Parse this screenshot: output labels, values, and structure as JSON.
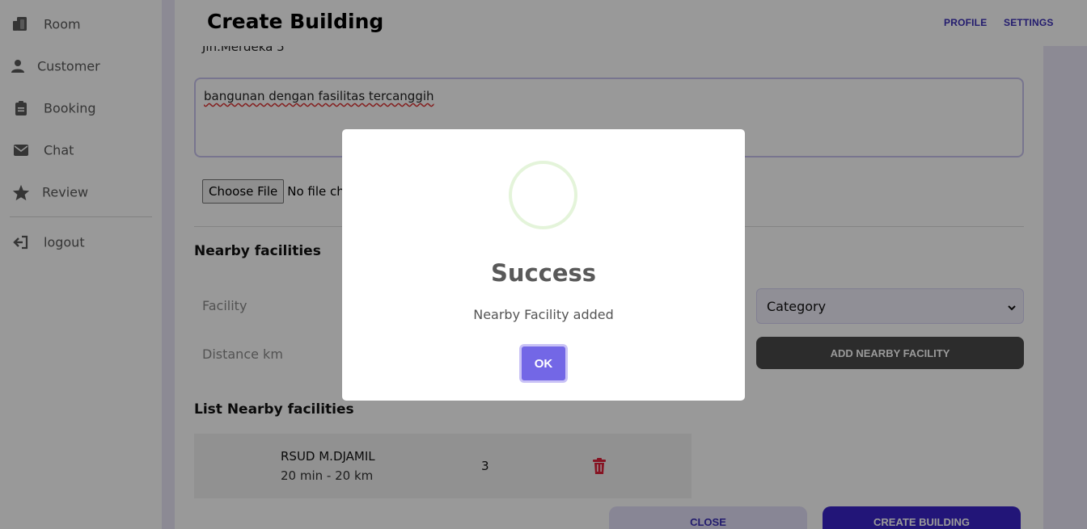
{
  "sidebar": {
    "items": [
      {
        "label": "Room",
        "icon": "room-icon"
      },
      {
        "label": "Customer",
        "icon": "user-icon"
      },
      {
        "label": "Booking",
        "icon": "clipboard-icon"
      },
      {
        "label": "Chat",
        "icon": "envelope-icon"
      },
      {
        "label": "Review",
        "icon": "star-icon"
      }
    ],
    "logout": {
      "label": "logout",
      "icon": "logout-icon"
    }
  },
  "header": {
    "title": "Create Building",
    "profile_label": "PROFILE",
    "settings_label": "SETTINGS"
  },
  "form": {
    "address_value": "Jln.Merdeka 5",
    "description_value": "bangunan dengan fasilitas tercanggih",
    "file_button_label": "Choose File",
    "file_status": "No file chosen",
    "nearby_title": "Nearby facilities",
    "facility_placeholder": "Facility",
    "distance_placeholder": "Distance km",
    "category_selected": "Category",
    "add_button_label": "ADD NEARBY FACILITY",
    "list_title": "List Nearby facilities",
    "list": [
      {
        "name": "RSUD M.DJAMIL",
        "detail": "20 min - 20 km",
        "count": "3"
      }
    ],
    "close_label": "CLOSE",
    "create_label": "CREATE BUILDING"
  },
  "modal": {
    "title": "Success",
    "message": "Nearby Facility added",
    "ok_label": "OK"
  },
  "colors": {
    "accent": "#3a24c8",
    "ok_button": "#7367e6",
    "delete": "#e0203a"
  }
}
